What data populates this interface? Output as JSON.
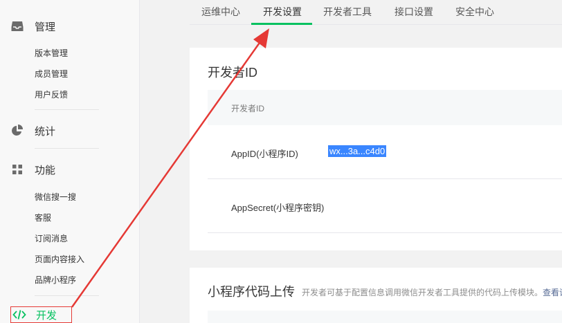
{
  "sidebar": {
    "groups": [
      {
        "title": "管理",
        "icon": "inbox-icon",
        "items": [
          "版本管理",
          "成员管理",
          "用户反馈"
        ]
      },
      {
        "title": "统计",
        "icon": "pie-chart-icon",
        "items": []
      },
      {
        "title": "功能",
        "icon": "grid-icon",
        "items": [
          "微信搜一搜",
          "客服",
          "订阅消息",
          "页面内容接入",
          "品牌小程序"
        ]
      }
    ],
    "active": {
      "title": "开发",
      "icon": "code-icon"
    }
  },
  "tabs": [
    "运维中心",
    "开发设置",
    "开发者工具",
    "接口设置",
    "安全中心"
  ],
  "active_tab": "开发设置",
  "developer_id": {
    "title": "开发者ID",
    "table_header": "开发者ID",
    "rows": [
      {
        "label": "AppID(小程序ID)",
        "value": "wx...3a...c4d0"
      },
      {
        "label": "AppSecret(小程序密钥)",
        "value": ""
      }
    ]
  },
  "code_upload": {
    "title": "小程序代码上传",
    "description": "开发者可基于配置信息调用微信开发者工具提供的代码上传模块。",
    "link": "查看详"
  },
  "colors": {
    "accent": "#07c160",
    "annotation": "#e53935",
    "selection": "#3a86ff"
  }
}
